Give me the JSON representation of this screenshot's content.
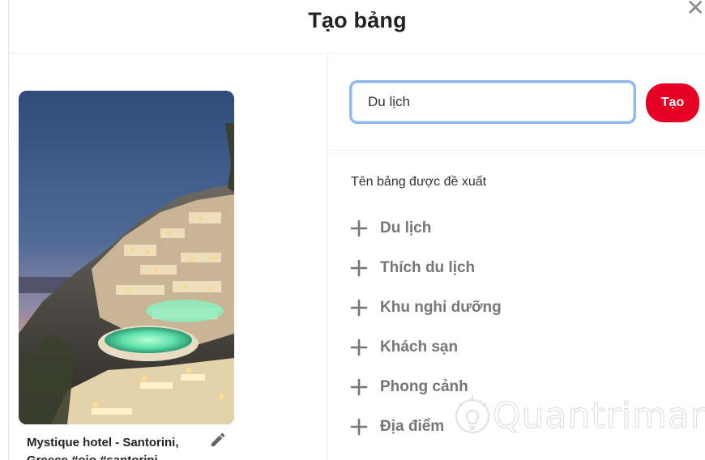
{
  "dialog": {
    "title": "Tạo bảng",
    "close_glyph": "✕"
  },
  "pin": {
    "caption": "Mystique hotel - Santorini, Greece #ojo #santorini"
  },
  "form": {
    "board_name_value": "Du lịch",
    "create_label": "Tạo"
  },
  "suggestions": {
    "title": "Tên bảng được đề xuất",
    "items": [
      {
        "label": "Du lịch"
      },
      {
        "label": "Thích du lịch"
      },
      {
        "label": "Khu nghỉ dưỡng"
      },
      {
        "label": "Khách sạn"
      },
      {
        "label": "Phong cảnh"
      },
      {
        "label": "Địa điểm"
      }
    ]
  },
  "watermark": {
    "text": "Quantrimang"
  },
  "icons": {
    "close": "close-icon",
    "edit": "pencil-icon",
    "add": "plus-icon"
  },
  "colors": {
    "accent": "#e60023",
    "focus_border": "#8fb8f0",
    "suggestion_text": "#767676"
  }
}
